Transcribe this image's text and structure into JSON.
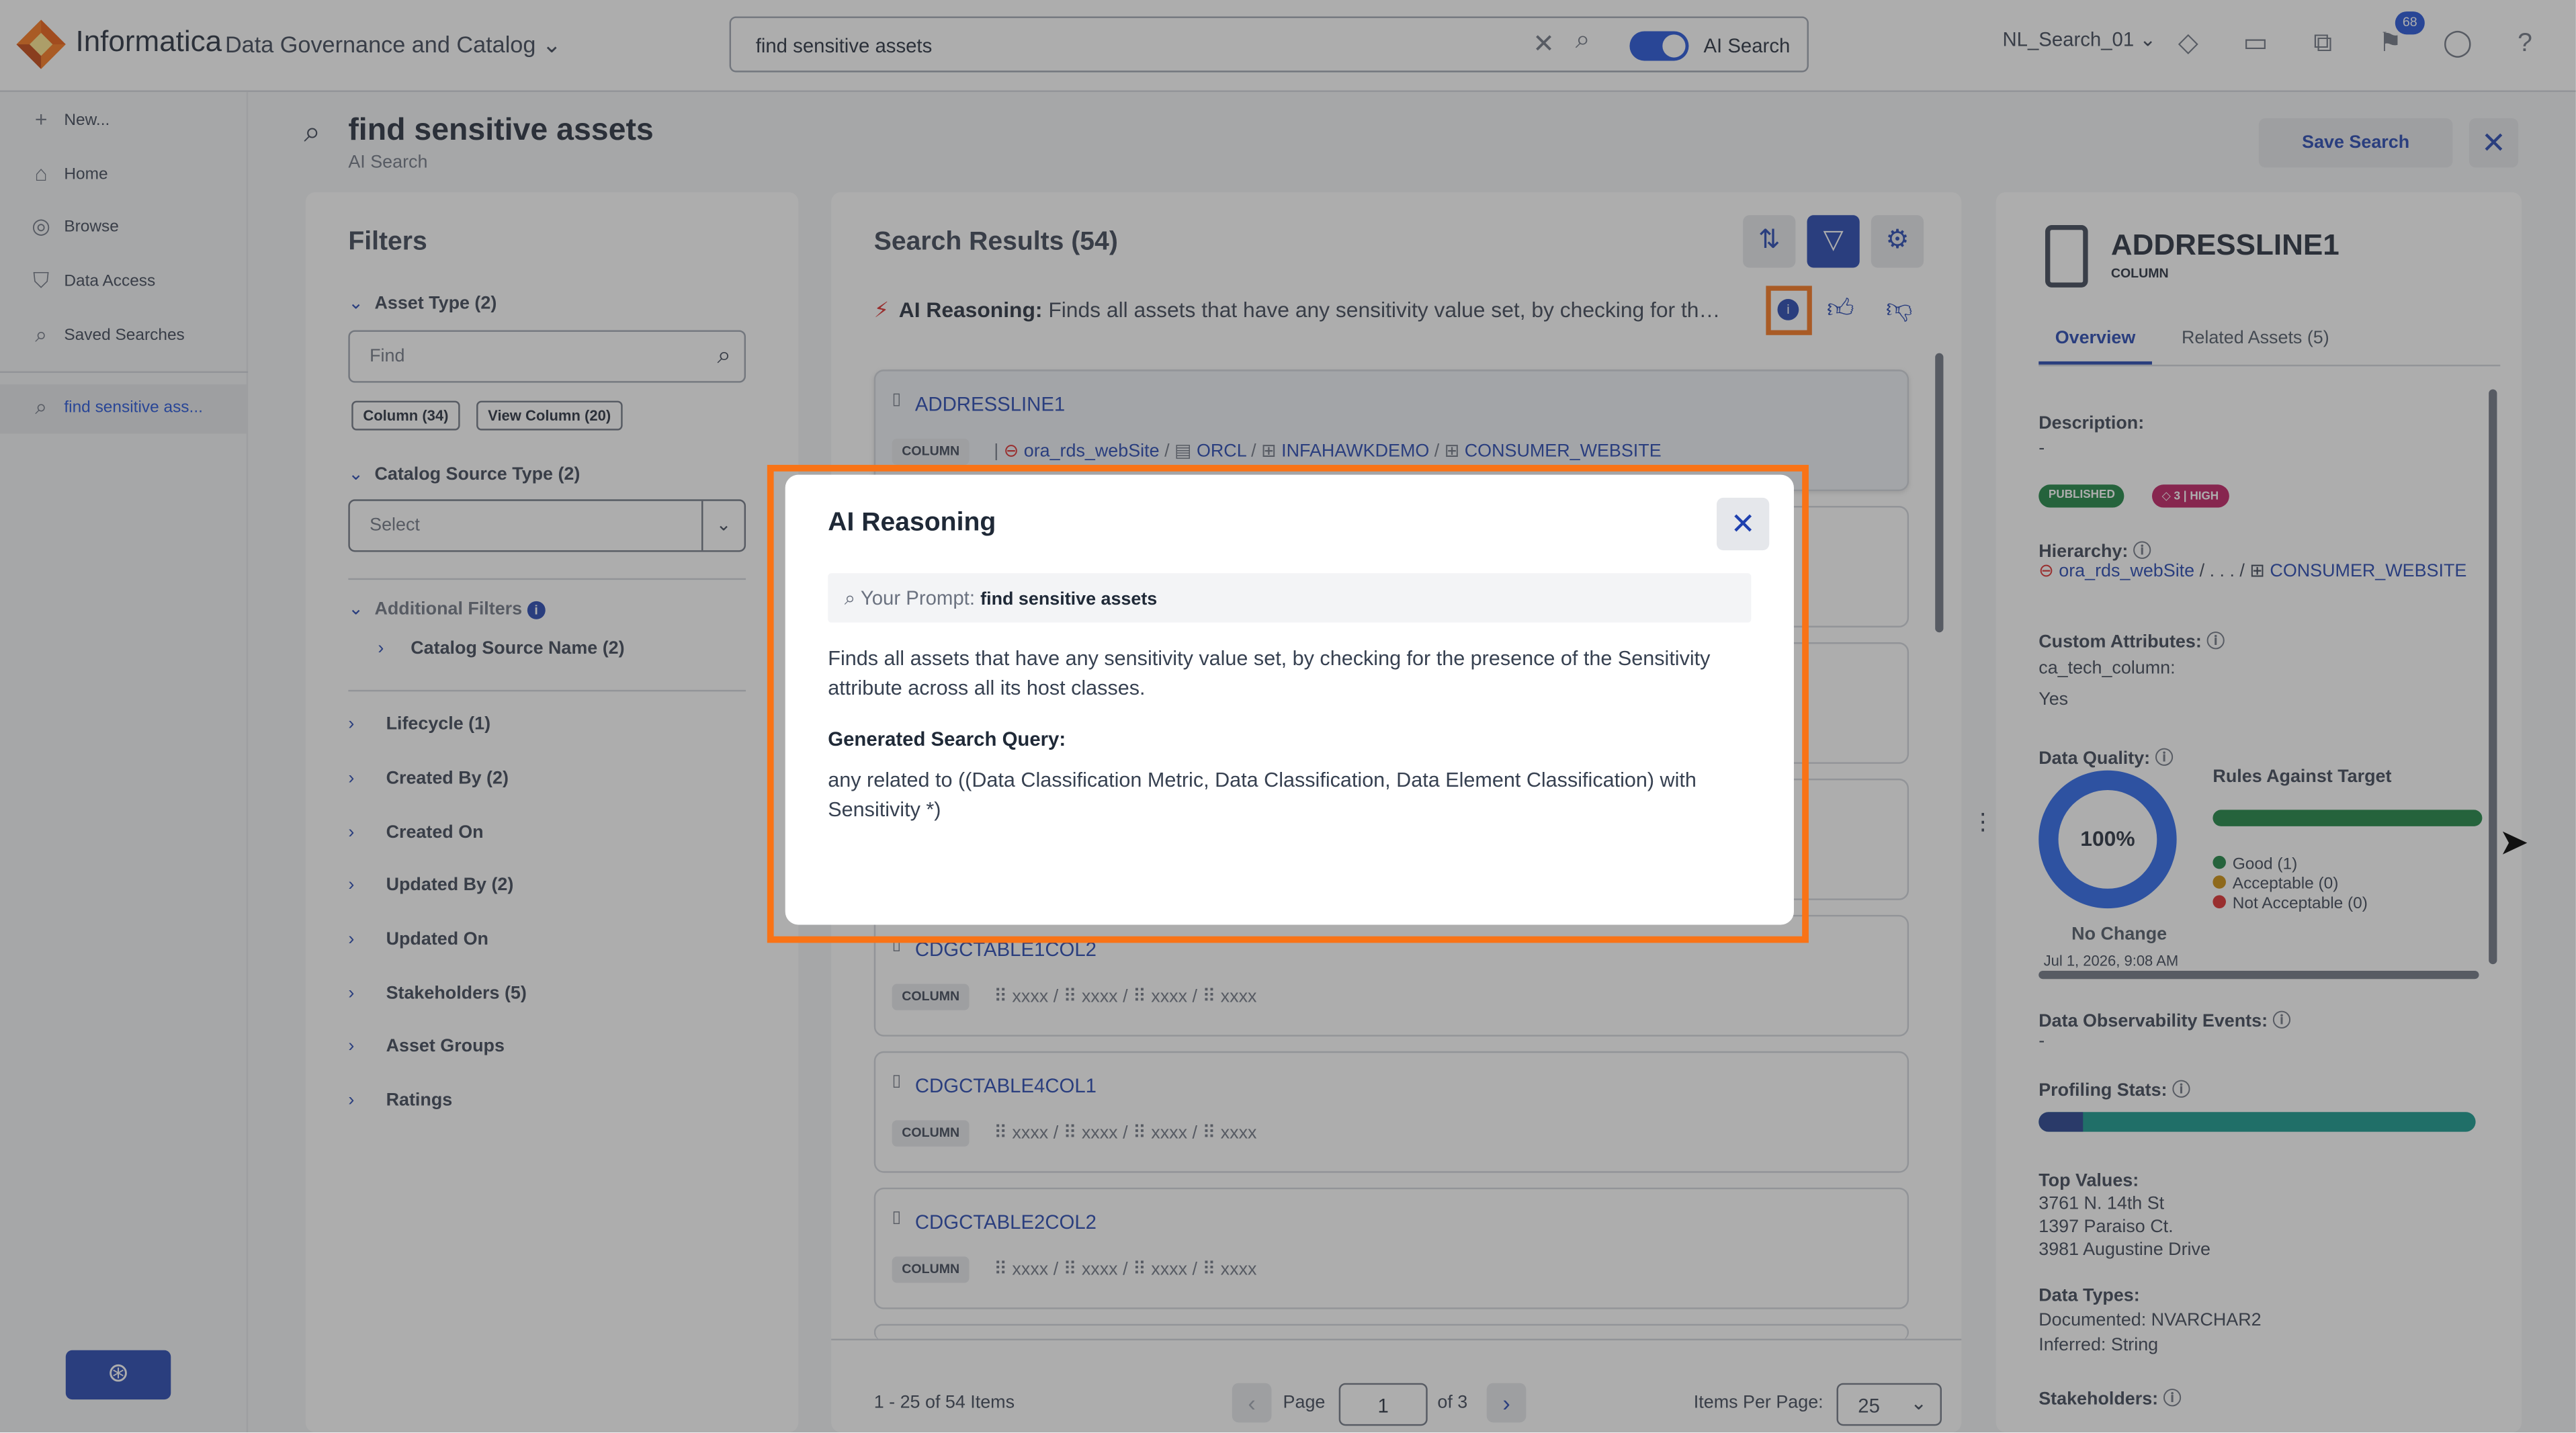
{
  "header": {
    "brand": "Informatica",
    "product": "Data Governance and Catalog",
    "search_value": "find sensitive assets",
    "ai_search_label": "AI Search",
    "org_name": "NL_Search_01",
    "notification_count": "68"
  },
  "nav": {
    "items": [
      {
        "label": "New...",
        "icon": "plus-icon"
      },
      {
        "label": "Home",
        "icon": "home-icon"
      },
      {
        "label": "Browse",
        "icon": "compass-icon"
      },
      {
        "label": "Data Access",
        "icon": "shield-icon"
      },
      {
        "label": "Saved Searches",
        "icon": "saved-search-icon"
      }
    ],
    "active_search": "find sensitive ass..."
  },
  "page": {
    "title": "find sensitive assets",
    "subtitle": "AI Search",
    "save_label": "Save Search"
  },
  "filters": {
    "title": "Filters",
    "asset_type": "Asset Type (2)",
    "find_placeholder": "Find",
    "chips": [
      "Column (34)",
      "View Column (20)"
    ],
    "catalog_source_type": "Catalog Source Type (2)",
    "select_placeholder": "Select",
    "additional_filters": "Additional Filters",
    "catalog_source_name": "Catalog Source Name (2)",
    "items": [
      "Lifecycle (1)",
      "Created By (2)",
      "Created On",
      "Updated By (2)",
      "Updated On",
      "Stakeholders (5)",
      "Asset Groups",
      "Ratings"
    ]
  },
  "results": {
    "title": "Search Results (54)",
    "reasoning_label": "AI Reasoning:",
    "reasoning_text": "Finds all assets that have any sensitivity value set, by checking for the pre...",
    "cards": [
      {
        "name": "ADDRESSLINE1",
        "type": "COLUMN",
        "path": [
          "ora_rds_webSite",
          "ORCL",
          "INFAHAWKDEMO",
          "CONSUMER_WEBSITE"
        ]
      },
      {
        "name": "CDGCTABLE1COL2",
        "type": "COLUMN",
        "path": [
          "xxxx",
          "xxxx",
          "xxxx",
          "xxxx"
        ]
      },
      {
        "name": "CDGCTABLE4COL1",
        "type": "COLUMN",
        "path": [
          "xxxx",
          "xxxx",
          "xxxx",
          "xxxx"
        ]
      },
      {
        "name": "CDGCTABLE2COL2",
        "type": "COLUMN",
        "path": [
          "xxxx",
          "xxxx",
          "xxxx",
          "xxxx"
        ]
      }
    ],
    "range_text": "1 - 25 of 54 Items",
    "page_label": "Page",
    "page_value": "1",
    "of_label": "of 3",
    "items_per_page_label": "Items Per Page:",
    "items_per_page_value": "25"
  },
  "detail": {
    "name": "ADDRESSLINE1",
    "type": "COLUMN",
    "tabs": [
      "Overview",
      "Related Assets (5)"
    ],
    "description_label": "Description:",
    "description_value": "-",
    "status_badge": "PUBLISHED",
    "sensitivity_badge": "3 | HIGH",
    "hierarchy_label": "Hierarchy:",
    "hierarchy_source": "ora_rds_webSite",
    "hierarchy_sep": "/ . . . /",
    "hierarchy_table": "CONSUMER_WEBSITE",
    "custom_attributes_label": "Custom Attributes:",
    "custom_attr_name": "ca_tech_column:",
    "custom_attr_value": "Yes",
    "data_quality_label": "Data Quality:",
    "dq_score": "100%",
    "dq_change": "No Change",
    "dq_date": "Jul 1, 2026, 9:08 AM",
    "rules_label": "Rules Against Target",
    "rules_good": "Good (1)",
    "rules_acceptable": "Acceptable (0)",
    "rules_not_acceptable": "Not Acceptable (0)",
    "observability_label": "Data Observability Events:",
    "observability_value": "-",
    "profiling_label": "Profiling Stats:",
    "profiling_null_fraction": 0.1,
    "top_values_label": "Top Values:",
    "top_values": [
      "3761 N. 14th St",
      "1397 Paraiso Ct.",
      "3981 Augustine Drive"
    ],
    "data_types_label": "Data Types:",
    "documented_type": "Documented: NVARCHAR2",
    "inferred_type": "Inferred: String",
    "stakeholders_label": "Stakeholders:"
  },
  "modal": {
    "title": "AI Reasoning",
    "prompt_label": "Your Prompt:",
    "prompt_value": "find sensitive assets",
    "explanation": "Finds all assets that have any sensitivity value set, by checking for the presence of the Sensitivity attribute across all its host classes.",
    "query_label": "Generated Search Query:",
    "query": "any related to ((Data Classification Metric, Data Classification, Data Element Classification) with Sensitivity *)"
  },
  "colors": {
    "accent": "#1e40af",
    "highlight": "#f97316",
    "published": "#15803d",
    "high": "#be185d"
  }
}
